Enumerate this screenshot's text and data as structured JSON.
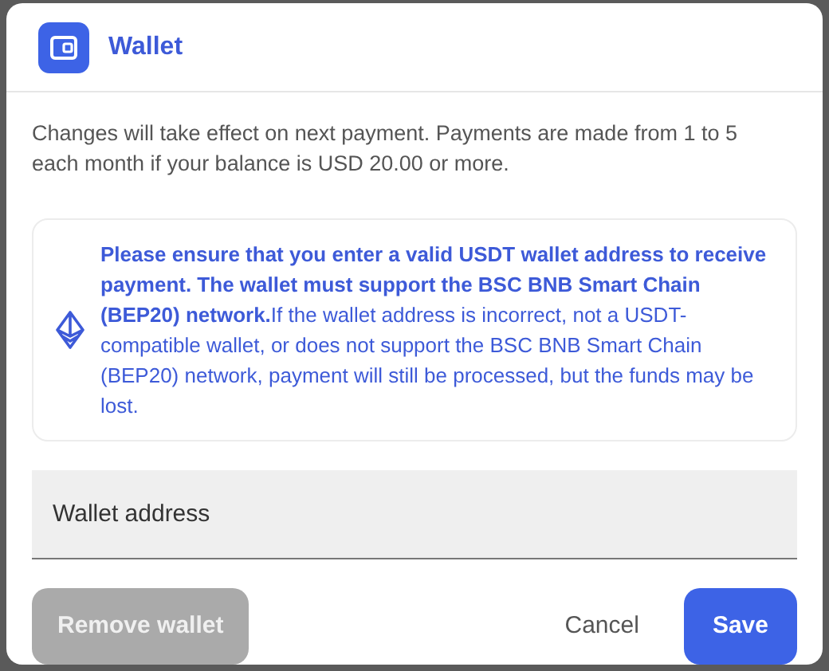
{
  "dialog": {
    "title": "Wallet",
    "description": "Changes will take effect on next payment. Payments are made from 1 to 5 each month if your balance is USD 20.00 or more.",
    "notice": "**Please ensure that you enter a valid USDT wallet address to receive payment. The wallet must support the BSC BNB Smart Chain (BEP20) network.**If the wallet address is incorrect, not a USDT-compatible wallet, or does not support the BSC BNB Smart Chain (BEP20) network, payment will still be processed, but the funds may be lost.",
    "wallet_field": {
      "placeholder": "Wallet address"
    },
    "buttons": [
      {
        "kind": "secondary",
        "label": "Remove wallet",
        "disabled": true
      },
      {
        "kind": "text",
        "label": "Cancel",
        "disabled": false
      },
      {
        "kind": "primary",
        "label": "Save",
        "disabled": false
      }
    ]
  }
}
